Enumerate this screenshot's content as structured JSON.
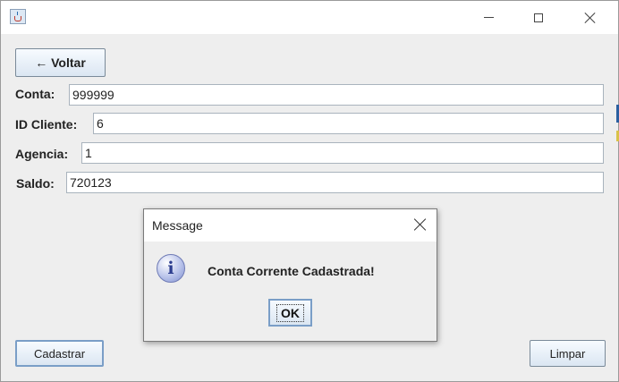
{
  "window": {
    "title": "",
    "controls": {
      "minimize_icon": "minimize-icon",
      "maximize_icon": "maximize-icon",
      "close_icon": "close-icon"
    }
  },
  "form": {
    "back_label": "← Voltar",
    "fields": [
      {
        "label": "Conta:",
        "value": "999999"
      },
      {
        "label": "ID Cliente:",
        "value": "6"
      },
      {
        "label": "Agencia:",
        "value": "1"
      },
      {
        "label": "Saldo:",
        "value": "720123"
      }
    ],
    "submit_label": "Cadastrar",
    "clear_label": "Limpar"
  },
  "dialog": {
    "title": "Message",
    "message": "Conta Corrente Cadastrada!",
    "ok_label": "OK",
    "icon": "info-icon",
    "icon_glyph": "i"
  },
  "colors": {
    "accent": "#7a9ec7",
    "window_bg": "#eeeeee"
  }
}
